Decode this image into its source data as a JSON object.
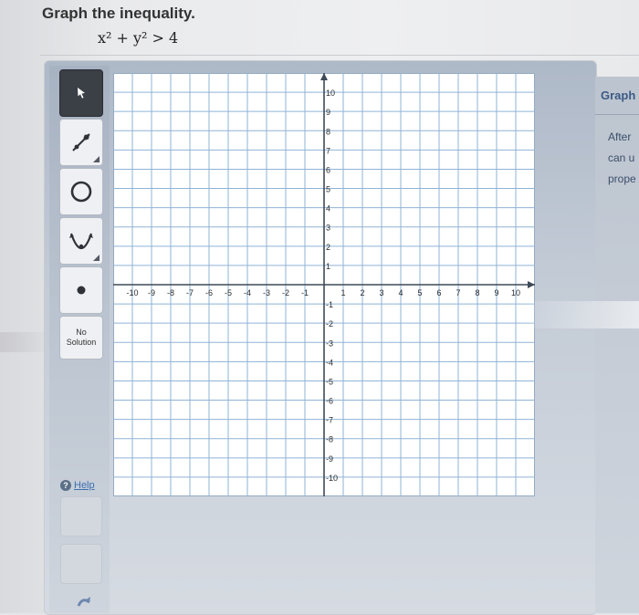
{
  "question": {
    "title": "Graph the inequality.",
    "equation": "x² + y² > 4"
  },
  "toolbar": {
    "tools": [
      {
        "name": "pointer",
        "icon": "arrow-pointer-icon",
        "active": true
      },
      {
        "name": "line",
        "icon": "line-segment-icon",
        "active": false
      },
      {
        "name": "circle",
        "icon": "circle-icon",
        "active": false
      },
      {
        "name": "parabola",
        "icon": "parabola-icon",
        "active": false
      },
      {
        "name": "point",
        "icon": "point-dot-icon",
        "active": false
      }
    ],
    "no_solution_label": "No Solution",
    "help_label": "Help"
  },
  "graph": {
    "x_ticks": [
      "-10",
      "-9",
      "-8",
      "-7",
      "-6",
      "-5",
      "-4",
      "-3",
      "-2",
      "-1",
      "1",
      "2",
      "3",
      "4",
      "5",
      "6",
      "7",
      "8",
      "9",
      "10"
    ],
    "y_ticks": [
      "10",
      "9",
      "8",
      "7",
      "6",
      "5",
      "4",
      "3",
      "2",
      "1",
      "-1",
      "-2",
      "-3",
      "-4",
      "-5",
      "-6",
      "-7",
      "-8",
      "-9",
      "-10"
    ],
    "xlim": [
      -11,
      11
    ],
    "ylim": [
      -11,
      11
    ],
    "grid": true
  },
  "right_panel": {
    "title": "Graph",
    "lines": [
      "After",
      "can u",
      "prope"
    ]
  },
  "colors": {
    "grid": "#8fb3d6",
    "axis": "#3f4a57",
    "link": "#3f6fb0"
  }
}
